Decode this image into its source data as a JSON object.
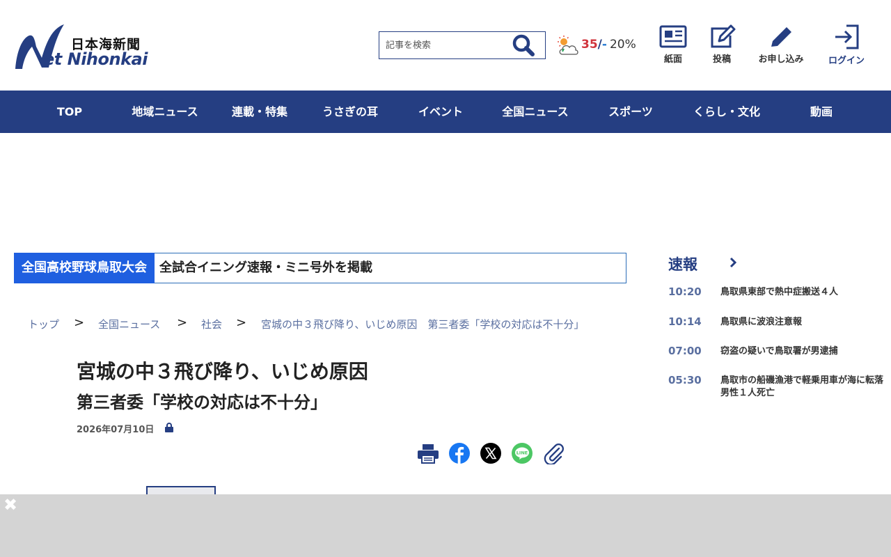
{
  "logo": {
    "jp": "日本海新聞",
    "en": "et Nihonkai"
  },
  "search": {
    "placeholder": "記事を検索"
  },
  "weather": {
    "high": "35",
    "sep": "/",
    "low": "-",
    "rain": "20%"
  },
  "header_buttons": {
    "paper": "紙面",
    "post": "投稿",
    "apply": "お申し込み",
    "login": "ログイン"
  },
  "nav": [
    "TOP",
    "地域ニュース",
    "連載・特集",
    "うさぎの耳",
    "イベント",
    "全国ニュース",
    "スポーツ",
    "くらし・文化",
    "動画"
  ],
  "banner": {
    "tag": "全国高校野球鳥取大会",
    "text": "全試合イニング速報・ミニ号外を掲載"
  },
  "breadcrumb": [
    "トップ",
    "全国ニュース",
    "社会",
    "宮城の中３飛び降り、いじめ原因　第三者委「学校の対応は不十分」"
  ],
  "breadcrumb_sep": ">",
  "article": {
    "title": "宮城の中３飛び降り、いじめ原因",
    "subtitle": "第三者委「学校の対応は不十分」",
    "date": "2026年07月10日"
  },
  "sidebar": {
    "heading": "速報",
    "items": [
      {
        "time": "10:20",
        "title": "鳥取県東部で熱中症搬送４人"
      },
      {
        "time": "10:14",
        "title": "鳥取県に波浪注意報"
      },
      {
        "time": "07:00",
        "title": "窃盗の疑いで鳥取署が男逮捕"
      },
      {
        "time": "05:30",
        "title": "鳥取市の船磯漁港で軽乗用車が海に転落　男性１人死亡"
      }
    ]
  },
  "ad": {
    "close": "✖"
  },
  "colors": {
    "brand": "#253e82",
    "banner_tag": "#1f5fe0",
    "temp_high": "#d0343d",
    "temp_low": "#2a7bd1"
  }
}
